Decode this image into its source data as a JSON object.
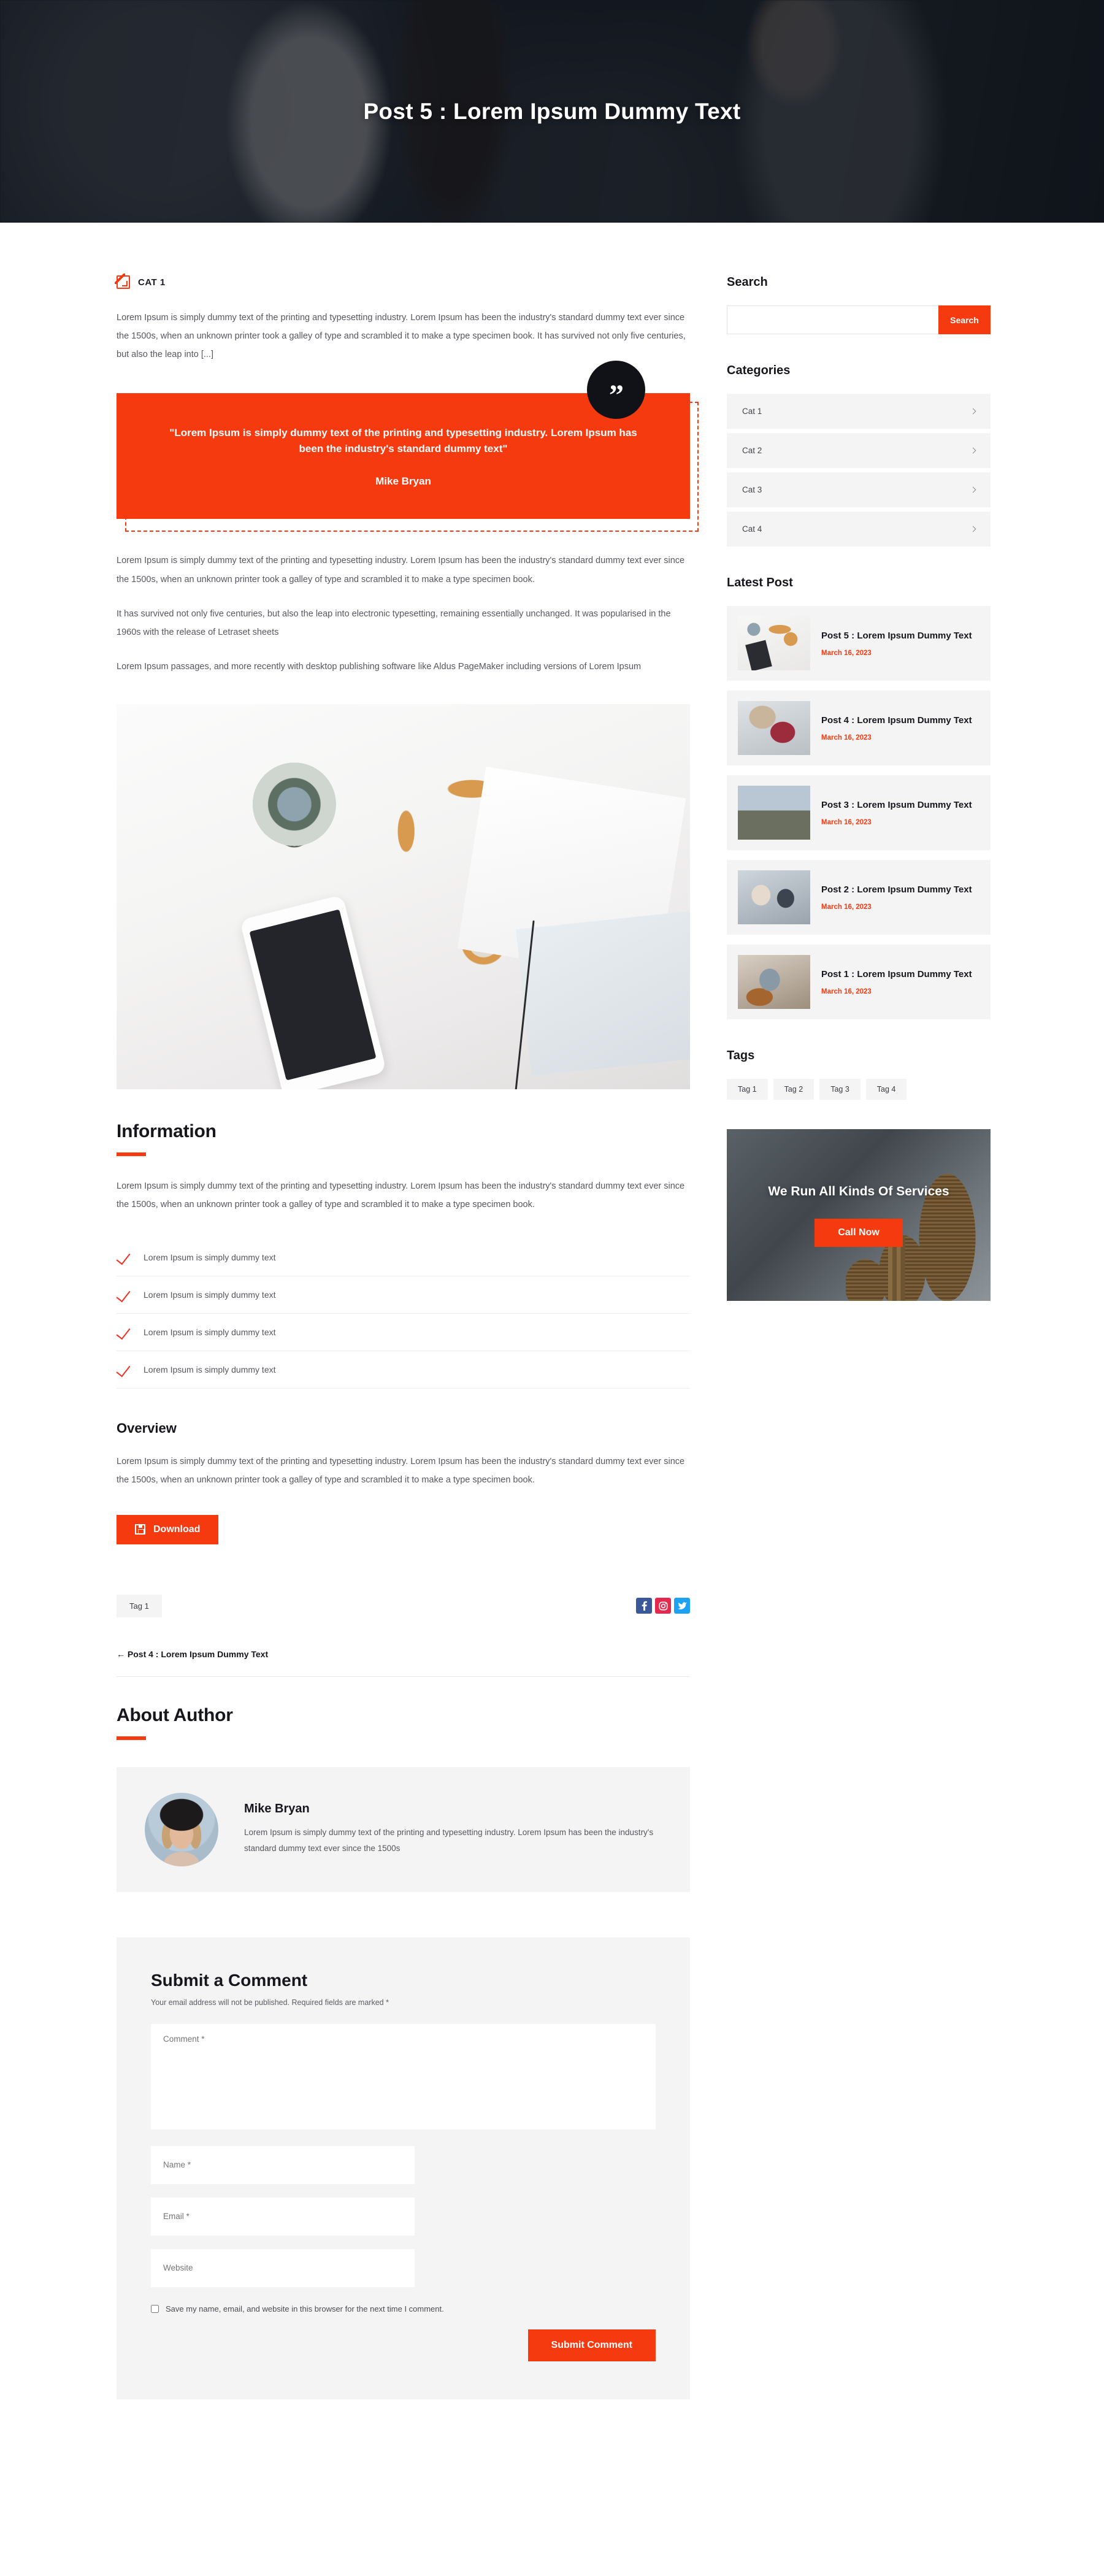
{
  "hero": {
    "title": "Post 5 : Lorem Ipsum Dummy Text"
  },
  "colors": {
    "accent": "#f63a10",
    "dark": "#16161d",
    "panel": "#f4f4f4",
    "facebook": "#3b5998",
    "instagram": "#e4294f",
    "twitter": "#1da1f2"
  },
  "article": {
    "category": "CAT 1",
    "category_icon": "category-tag-icon",
    "intro": "Lorem Ipsum is simply dummy text of the printing and typesetting industry. Lorem Ipsum has been the industry's standard dummy text ever since the 1500s, when an unknown printer took a galley of type and scrambled it to make a type specimen book. It has survived not only five centuries, but also the leap into [...]",
    "quote": {
      "icon": "quote-mark-icon",
      "text": "\"Lorem Ipsum is simply dummy text of the printing and typesetting industry. Lorem Ipsum has been the industry's standard dummy text\"",
      "author": "Mike Bryan"
    },
    "paragraphs": [
      "Lorem Ipsum is simply dummy text of the printing and typesetting industry. Lorem Ipsum has been the industry's standard dummy text ever since the 1500s, when an unknown printer took a galley of type and scrambled it to make a type specimen book.",
      "It has survived not only five centuries, but also the leap into electronic typesetting, remaining essentially unchanged. It was popularised in the 1960s with the release of Letraset sheets",
      "Lorem Ipsum passages, and more recently with desktop publishing software like Aldus PageMaker including versions of Lorem Ipsum"
    ],
    "featured_image_alt": "headphones phone and succulent flat lay on white desk"
  },
  "information": {
    "heading": "Information",
    "paragraph": "Lorem Ipsum is simply dummy text of the printing and typesetting industry. Lorem Ipsum has been the industry's standard dummy text ever since the 1500s, when an unknown printer took a galley of type and scrambled it to make a type specimen book.",
    "items": [
      "Lorem Ipsum is simply dummy text",
      "Lorem Ipsum is simply dummy text",
      "Lorem Ipsum is simply dummy text",
      "Lorem Ipsum is simply dummy text"
    ]
  },
  "overview": {
    "heading": "Overview",
    "paragraph": "Lorem Ipsum is simply dummy text of the printing and typesetting industry. Lorem Ipsum has been the industry's standard dummy text ever since the 1500s, when an unknown printer took a galley of type and scrambled it to make a type specimen book.",
    "download_label": "Download",
    "download_icon": "save-floppy-icon"
  },
  "post_footer": {
    "tag": "Tag 1",
    "socials": [
      {
        "name": "facebook-icon",
        "glyph": "f"
      },
      {
        "name": "instagram-icon",
        "glyph": "▢"
      },
      {
        "name": "twitter-icon",
        "glyph": "ᵛ"
      }
    ],
    "prev_link": "← Post 4 : Lorem Ipsum Dummy Text"
  },
  "author": {
    "heading": "About Author",
    "name": "Mike Bryan",
    "bio": "Lorem Ipsum is simply dummy text of the printing and typesetting industry. Lorem Ipsum has been the industry's standard dummy text ever since the 1500s",
    "avatar_alt": "author portrait"
  },
  "comment_form": {
    "title": "Submit a Comment",
    "note": "Your email address will not be published. Required fields are marked *",
    "comment_placeholder": "Comment *",
    "name_placeholder": "Name *",
    "email_placeholder": "Email *",
    "website_placeholder": "Website",
    "save_label": "Save my name, email, and website in this browser for the next time I comment.",
    "submit_label": "Submit Comment"
  },
  "sidebar": {
    "search": {
      "title": "Search",
      "value": "",
      "placeholder": "",
      "button": "Search"
    },
    "categories": {
      "title": "Categories",
      "items": [
        "Cat 1",
        "Cat 2",
        "Cat 3",
        "Cat 4"
      ]
    },
    "latest": {
      "title": "Latest Post",
      "items": [
        {
          "title": "Post 5 : Lorem Ipsum Dummy Text",
          "date": "March 16, 2023",
          "thumb": "t1"
        },
        {
          "title": "Post 4 : Lorem Ipsum Dummy Text",
          "date": "March 16, 2023",
          "thumb": "t2"
        },
        {
          "title": "Post 3 : Lorem Ipsum Dummy Text",
          "date": "March 16, 2023",
          "thumb": "t3"
        },
        {
          "title": "Post 2 : Lorem Ipsum Dummy Text",
          "date": "March 16, 2023",
          "thumb": "t4"
        },
        {
          "title": "Post 1 : Lorem Ipsum Dummy Text",
          "date": "March 16, 2023",
          "thumb": "t5"
        }
      ]
    },
    "tags": {
      "title": "Tags",
      "items": [
        "Tag 1",
        "Tag 2",
        "Tag 3",
        "Tag 4"
      ]
    },
    "promo": {
      "title": "We Run All Kinds Of Services",
      "button": "Call Now"
    }
  }
}
